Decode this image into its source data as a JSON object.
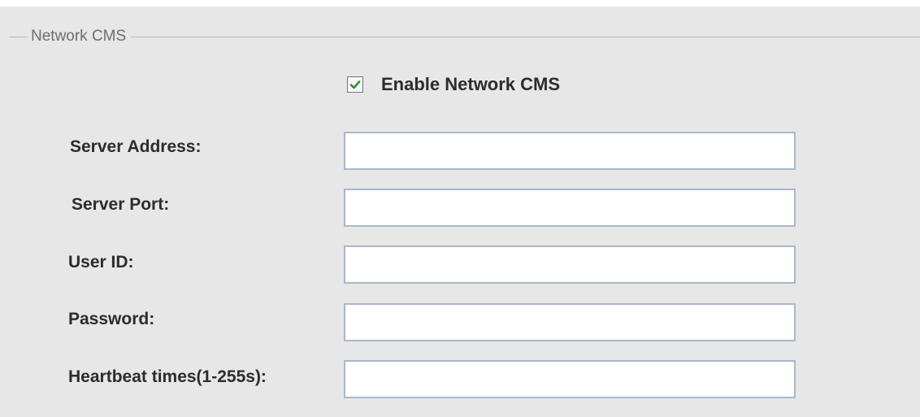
{
  "group": {
    "title": "Network CMS"
  },
  "enable_checkbox": {
    "label": "Enable Network CMS",
    "checked": true,
    "check_icon": "checkmark-icon",
    "check_color": "#2f8f2f"
  },
  "fields": {
    "server_address": {
      "label": "Server Address:",
      "value": ""
    },
    "server_port": {
      "label": "Server Port:",
      "value": ""
    },
    "user_id": {
      "label": "User ID:",
      "value": ""
    },
    "password": {
      "label": "Password:",
      "value": ""
    },
    "heartbeat": {
      "label": "Heartbeat times(1-255s):",
      "value": ""
    }
  }
}
